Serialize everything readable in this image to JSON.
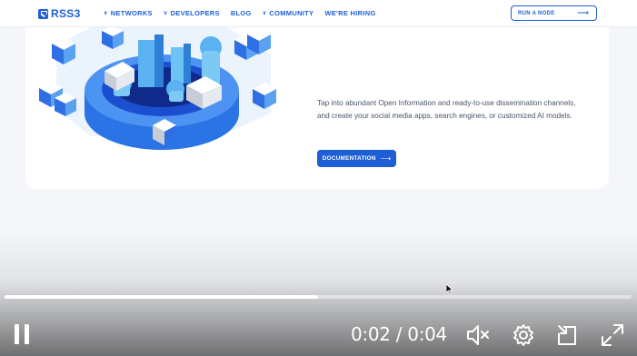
{
  "site": {
    "logo_text": "RSS3",
    "nav": [
      {
        "label": "NETWORKS",
        "has_caret": true
      },
      {
        "label": "DEVELOPERS",
        "has_caret": true
      },
      {
        "label": "BLOG",
        "has_caret": false
      },
      {
        "label": "COMMUNITY",
        "has_caret": true
      },
      {
        "label": "WE'RE HIRING",
        "has_caret": false
      }
    ],
    "cta_label": "RUN A NODE",
    "cta_icon": "arrow-right-icon",
    "brand_color": "#1f5fd6"
  },
  "section": {
    "description": "Tap into abundant Open Information and ready-to-use dissemination channels, and create your social media apps, search engines, or customized AI models.",
    "button_label": "DOCUMENTATION",
    "button_icon": "arrow-right-icon"
  },
  "player": {
    "current_time": "0:02",
    "duration": "0:04",
    "time_display": "0:02 / 0:04",
    "progress": 0.5,
    "state": "playing",
    "muted": true,
    "icons": [
      "pause-icon",
      "mute-icon",
      "settings-icon",
      "pip-icon",
      "fullscreen-icon"
    ]
  }
}
